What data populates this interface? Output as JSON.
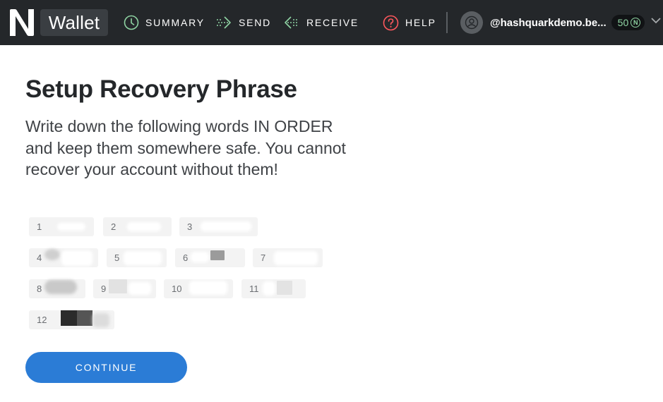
{
  "header": {
    "app_name": "Wallet",
    "nav": [
      {
        "label": "SUMMARY",
        "icon": "clock-icon"
      },
      {
        "label": "SEND",
        "icon": "send-arrow-icon"
      },
      {
        "label": "RECEIVE",
        "icon": "receive-arrow-icon"
      },
      {
        "label": "HELP",
        "icon": "help-circle-icon"
      }
    ],
    "account_name": "@hashquarkdemo.be...",
    "balance": "50",
    "balance_symbol": "N"
  },
  "main": {
    "title": "Setup Recovery Phrase",
    "subtitle": "Write down the following words IN ORDER and keep them somewhere safe. You cannot recover your account without them!",
    "words": [
      {
        "number": "1"
      },
      {
        "number": "2"
      },
      {
        "number": "3"
      },
      {
        "number": "4"
      },
      {
        "number": "5"
      },
      {
        "number": "6"
      },
      {
        "number": "7"
      },
      {
        "number": "8"
      },
      {
        "number": "9"
      },
      {
        "number": "10"
      },
      {
        "number": "11"
      },
      {
        "number": "12"
      }
    ],
    "continue_label": "CONTINUE"
  },
  "colors": {
    "header_bg": "#24272a",
    "accent": "#2b7cd6",
    "balance_text": "#8fd4a3"
  }
}
